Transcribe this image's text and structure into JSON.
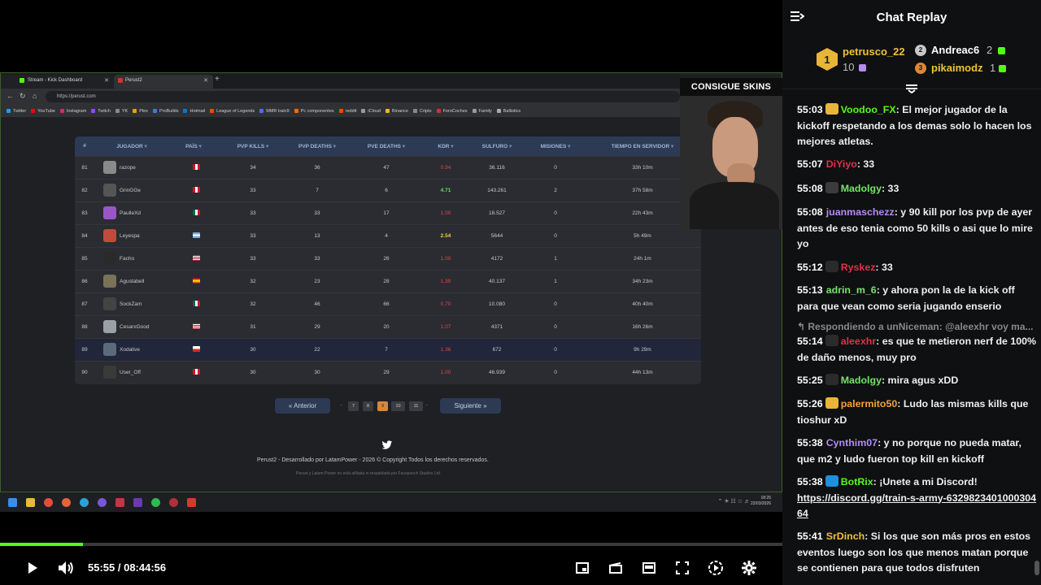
{
  "player": {
    "time_display": "55:55 / 08:44:56",
    "progress": 0.106,
    "accent": "#53fc18"
  },
  "browser": {
    "tabs": [
      {
        "label": "Stream - Kick Dashboard"
      },
      {
        "label": "Perust2"
      }
    ],
    "url": "https://perust.com",
    "bookmarks": [
      "Twitter",
      "YouTube",
      "Instagram",
      "Twitch",
      "YK",
      "Plex",
      "ProBuilds",
      "Hotmail",
      "League of Legends",
      "MMR train9",
      "Pc componentes",
      "reddit",
      "iCloud",
      "Binance",
      "Cripto",
      "ForoCoches",
      "Family",
      "Ballistics"
    ]
  },
  "table": {
    "headers": [
      "#",
      "JUGADOR",
      "PAÍS",
      "PVP KILLS",
      "PVP DEATHS",
      "PVE DEATHS",
      "KDR",
      "SULFURO",
      "MISIONES",
      "TIEMPO EN SERVIDOR"
    ],
    "rows": [
      {
        "rank": "81",
        "name": "razope",
        "flag": "pe",
        "pvp_kills": "34",
        "pvp_deaths": "36",
        "pve_deaths": "47",
        "kdr": "0.94",
        "kdr_color": "red",
        "sulfuro": "36.116",
        "misiones": "0",
        "tiempo": "33h 10m"
      },
      {
        "rank": "82",
        "name": "GrinGGe",
        "flag": "pe",
        "pvp_kills": "33",
        "pvp_deaths": "7",
        "pve_deaths": "6",
        "kdr": "4.71",
        "kdr_color": "green",
        "sulfuro": "143.261",
        "misiones": "2",
        "tiempo": "37h 58m"
      },
      {
        "rank": "83",
        "name": "PaulleXd",
        "flag": "mx",
        "pvp_kills": "33",
        "pvp_deaths": "33",
        "pve_deaths": "17",
        "kdr": "1.00",
        "kdr_color": "red",
        "sulfuro": "18.527",
        "misiones": "0",
        "tiempo": "22h 43m"
      },
      {
        "rank": "84",
        "name": "Leyespa",
        "flag": "ar",
        "pvp_kills": "33",
        "pvp_deaths": "13",
        "pve_deaths": "4",
        "kdr": "2.54",
        "kdr_color": "yellow",
        "sulfuro": "5644",
        "misiones": "0",
        "tiempo": "5h 49m"
      },
      {
        "rank": "85",
        "name": "Facho",
        "flag": "us",
        "pvp_kills": "33",
        "pvp_deaths": "33",
        "pve_deaths": "26",
        "kdr": "1.00",
        "kdr_color": "red",
        "sulfuro": "4172",
        "misiones": "1",
        "tiempo": "24h 1m"
      },
      {
        "rank": "86",
        "name": "Agustabell",
        "flag": "es",
        "pvp_kills": "32",
        "pvp_deaths": "23",
        "pve_deaths": "28",
        "kdr": "1.39",
        "kdr_color": "red",
        "sulfuro": "40.137",
        "misiones": "1",
        "tiempo": "34h 23m"
      },
      {
        "rank": "87",
        "name": "SockZam",
        "flag": "mx",
        "pvp_kills": "32",
        "pvp_deaths": "46",
        "pve_deaths": "66",
        "kdr": "0.70",
        "kdr_color": "red",
        "sulfuro": "10.080",
        "misiones": "0",
        "tiempo": "40h 40m"
      },
      {
        "rank": "88",
        "name": "CesarxGood",
        "flag": "us",
        "pvp_kills": "31",
        "pvp_deaths": "29",
        "pve_deaths": "20",
        "kdr": "1.07",
        "kdr_color": "red",
        "sulfuro": "4371",
        "misiones": "0",
        "tiempo": "16h 26m"
      },
      {
        "rank": "89",
        "name": "Xodalive",
        "flag": "cl",
        "pvp_kills": "30",
        "pvp_deaths": "22",
        "pve_deaths": "7",
        "kdr": "1.36",
        "kdr_color": "red",
        "sulfuro": "672",
        "misiones": "0",
        "tiempo": "9h 29m"
      },
      {
        "rank": "90",
        "name": "User_Off",
        "flag": "pe",
        "pvp_kills": "30",
        "pvp_deaths": "30",
        "pve_deaths": "29",
        "kdr": "1.00",
        "kdr_color": "red",
        "sulfuro": "46.939",
        "misiones": "0",
        "tiempo": "44h 13m"
      }
    ],
    "highlighted_rank": "89"
  },
  "pagination": {
    "prev": "« Anterior",
    "next": "Siguiente »",
    "pages": [
      "7",
      "8",
      "9",
      "10",
      "11"
    ],
    "current": "9",
    "dots": ".."
  },
  "site_footer": {
    "line1": "Perust2 - Desarrollado por LatamPower - 2026 © Copyright Todos los derechos reservados.",
    "line2": "Perust y Latam Power no está afiliada ni respaldada por Facepunch Studios Ltd."
  },
  "taskbar": {
    "clock_time": "18:26",
    "clock_date": "22/03/2026"
  },
  "webcam": {
    "label": "CONSIGUE SKINS"
  },
  "chat": {
    "title": "Chat Replay",
    "leaderboard": [
      {
        "rank": "1",
        "name": "petrusco_22",
        "count": "10",
        "color": "#f0c23a"
      },
      {
        "rank": "2",
        "name": "Andreac6",
        "count": "2",
        "color": "#ffffff"
      },
      {
        "rank": "3",
        "name": "pikaimodz",
        "count": "1",
        "color": "#f0c23a"
      }
    ],
    "messages": [
      {
        "ts": "55:03",
        "user": "Voodoo_FX",
        "color": "#53fc18",
        "text": "El mejor jugador de la kickoff respetando a los demas solo lo hacen los mejores atletas."
      },
      {
        "ts": "55:07",
        "user": "DiYiyo",
        "color": "#e0314b",
        "text": "33"
      },
      {
        "ts": "55:08",
        "user": "Madolgy",
        "color": "#74e36a",
        "text": "33"
      },
      {
        "ts": "55:08",
        "user": "juanmaschezz",
        "color": "#b48cf2",
        "text": "y 90 kill por los pvp de ayer antes de eso tenia como 50 kills o asi que lo mire yo"
      },
      {
        "ts": "55:12",
        "user": "Ryskez",
        "color": "#e0314b",
        "text": "33"
      },
      {
        "ts": "55:13",
        "user": "adrin_m_6",
        "color": "#74e36a",
        "text": "y ahora pon la de la kick off para que vean como seria jugando enserio"
      },
      {
        "reply": "Respondiendo a unNiceman: @aleexhr voy ma..."
      },
      {
        "ts": "55:14",
        "user": "aleexhr",
        "color": "#e0314b",
        "text": "es que te metieron nerf de 100% de daño menos, muy pro"
      },
      {
        "ts": "55:25",
        "user": "Madolgy",
        "color": "#74e36a",
        "text": "mira agus xDD"
      },
      {
        "ts": "55:26",
        "user": "palermito50",
        "color": "#f0a33a",
        "text": "Ludo las mismas kills que tioshur xD"
      },
      {
        "ts": "55:38",
        "user": "Cynthim07",
        "color": "#b48cf2",
        "text": "y no porque no pueda matar, que m2 y ludo fueron top kill en kickoff"
      },
      {
        "ts": "55:38",
        "user": "BotRix",
        "color": "#53fc18",
        "text": "¡Unete a mi Discord!",
        "link": "https://discord.gg/train-s-army-632982340100030464"
      },
      {
        "ts": "55:41",
        "user": "SrDinch",
        "color": "#f0c23a",
        "text": "Si los que son más pros en estos eventos luego son los que menos matan porque se contienen para que todos disfruten"
      }
    ]
  }
}
